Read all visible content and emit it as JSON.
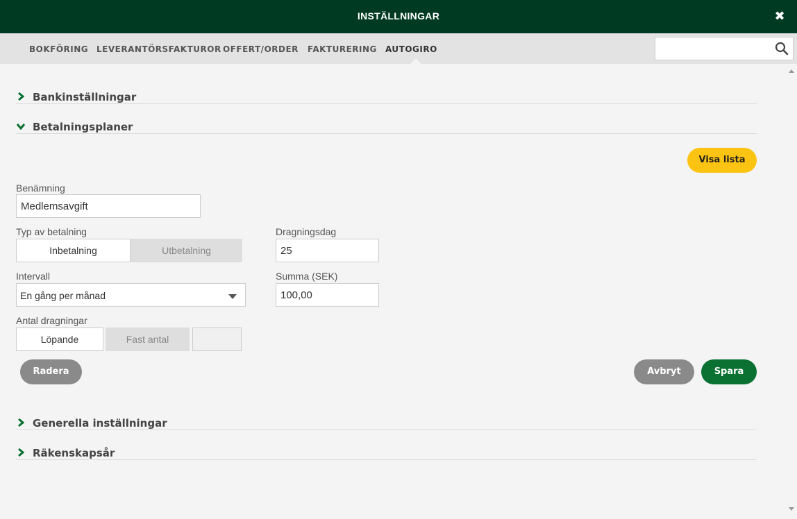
{
  "window": {
    "title": "INSTÄLLNINGAR",
    "close_icon": "close-icon"
  },
  "tabs": [
    {
      "label": "BOKFÖRING",
      "active": false
    },
    {
      "label": "LEVERANTÖRSFAKTUROR",
      "active": false
    },
    {
      "label": "OFFERT/ORDER",
      "active": false
    },
    {
      "label": "FAKTURERING",
      "active": false
    },
    {
      "label": "AUTOGIRO",
      "active": true
    }
  ],
  "search": {
    "value": "",
    "placeholder": "",
    "icon": "search-icon"
  },
  "sections": {
    "bank": {
      "label": "Bankinställningar",
      "expanded": false
    },
    "plans": {
      "label": "Betalningsplaner",
      "expanded": true
    },
    "general": {
      "label": "Generella inställningar",
      "expanded": false
    },
    "fiscal": {
      "label": "Räkenskapsår",
      "expanded": false
    }
  },
  "form": {
    "show_list_label": "Visa lista",
    "name_label": "Benämning",
    "name_value": "Medlemsavgift",
    "payment_type_label": "Typ av betalning",
    "payment_type_options": [
      "Inbetalning",
      "Utbetalning"
    ],
    "payment_type_selected": "Inbetalning",
    "interval_label": "Intervall",
    "interval_value": "En gång per månad",
    "count_label": "Antal dragningar",
    "count_options": [
      "Löpande",
      "Fast antal"
    ],
    "count_selected": "Löpande",
    "count_value": "",
    "day_label": "Dragningsdag",
    "day_value": "25",
    "amount_label": "Summa (SEK)",
    "amount_value": "100,00"
  },
  "actions": {
    "delete_label": "Radera",
    "cancel_label": "Avbryt",
    "save_label": "Spara"
  },
  "colors": {
    "header": "#013a23",
    "accent_green": "#0a7132",
    "yellow": "#fbc312",
    "grey_button": "#8a8a8a"
  }
}
